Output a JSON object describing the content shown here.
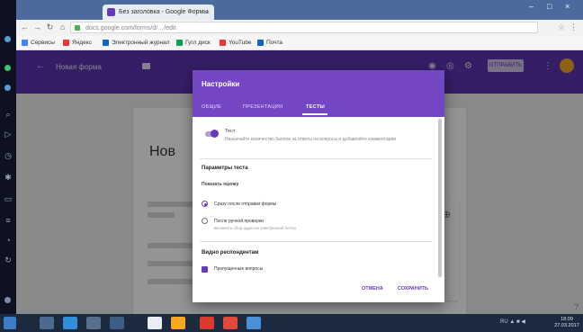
{
  "browser": {
    "tab_title": "Без заголовка - Google Формы",
    "tab_close": "×",
    "window_controls": [
      "–",
      "□",
      "×"
    ],
    "address": "docs.google.com/forms/d/…/edit",
    "star": "☆",
    "menu": "⋮",
    "bookmarks": [
      {
        "label": "Сервисы",
        "color": "#4285f4"
      },
      {
        "label": "Яндекс",
        "color": "#e53935"
      },
      {
        "label": "Электронный журнал",
        "color": "#1565c0"
      },
      {
        "label": "Гугл диск",
        "color": "#0f9d58"
      },
      {
        "label": "YouTube",
        "color": "#e53935"
      },
      {
        "label": "Почта",
        "color": "#1565c0"
      }
    ]
  },
  "app": {
    "title": "Новая форма",
    "send_label": "ОТПРАВИТЬ",
    "accent": "#673ab7",
    "header_color": "#5e35b1"
  },
  "form": {
    "title": "Нов"
  },
  "dialog": {
    "title": "Настройки",
    "tabs": [
      {
        "label": "ОБЩИЕ",
        "active": false
      },
      {
        "label": "ПРЕЗЕНТАЦИЯ",
        "active": false
      },
      {
        "label": "ТЕСТЫ",
        "active": true
      }
    ],
    "quiz_toggle_label": "Тест",
    "quiz_toggle_on": true,
    "quiz_toggle_desc": "Назначайте количество баллов за ответы на вопросы и добавляйте комментарии",
    "section_title": "Параметры теста",
    "section_sub": "Показать оценку",
    "radio_options": [
      {
        "label": "Сразу после отправки формы",
        "desc": "",
        "checked": true
      },
      {
        "label": "После ручной проверки",
        "desc": "Включить сбор адресов электронной почты",
        "checked": false
      }
    ],
    "section2_title": "Видно респондентам",
    "checkbox_label": "Пропущенные вопросы",
    "cancel_label": "ОТМЕНА",
    "save_label": "СОХРАНИТЬ"
  },
  "taskbar": {
    "tray": "RU ▲ ■ ◀",
    "time": "18:09",
    "date": "27.03.2017"
  }
}
